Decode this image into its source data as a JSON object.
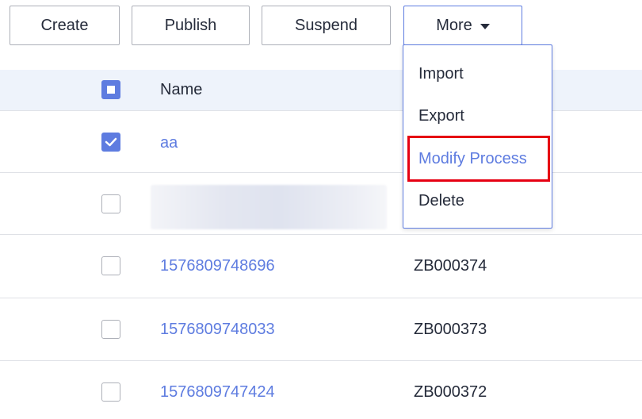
{
  "toolbar": {
    "create_label": "Create",
    "publish_label": "Publish",
    "suspend_label": "Suspend",
    "more_label": "More",
    "more_caret_icon": "caret-down-icon"
  },
  "dropdown": {
    "items": [
      {
        "label": "Import"
      },
      {
        "label": "Export"
      },
      {
        "label": "Modify Process",
        "state": "hover-highlighted"
      },
      {
        "label": "Delete"
      }
    ]
  },
  "table": {
    "header": {
      "select_all_state": "indeterminate",
      "name_label": "Name"
    },
    "rows": [
      {
        "checked": true,
        "name": "aa",
        "code": ""
      },
      {
        "checked": false,
        "name": "",
        "code": "",
        "redacted": true
      },
      {
        "checked": false,
        "name": "1576809748696",
        "code": "ZB000374"
      },
      {
        "checked": false,
        "name": "1576809748033",
        "code": "ZB000373"
      },
      {
        "checked": false,
        "name": "1576809747424",
        "code": "ZB000372"
      }
    ]
  },
  "colors": {
    "accent": "#5e7ce0",
    "header_bg": "#eef3fb",
    "highlight": "#e60012",
    "text": "#252b3a"
  }
}
